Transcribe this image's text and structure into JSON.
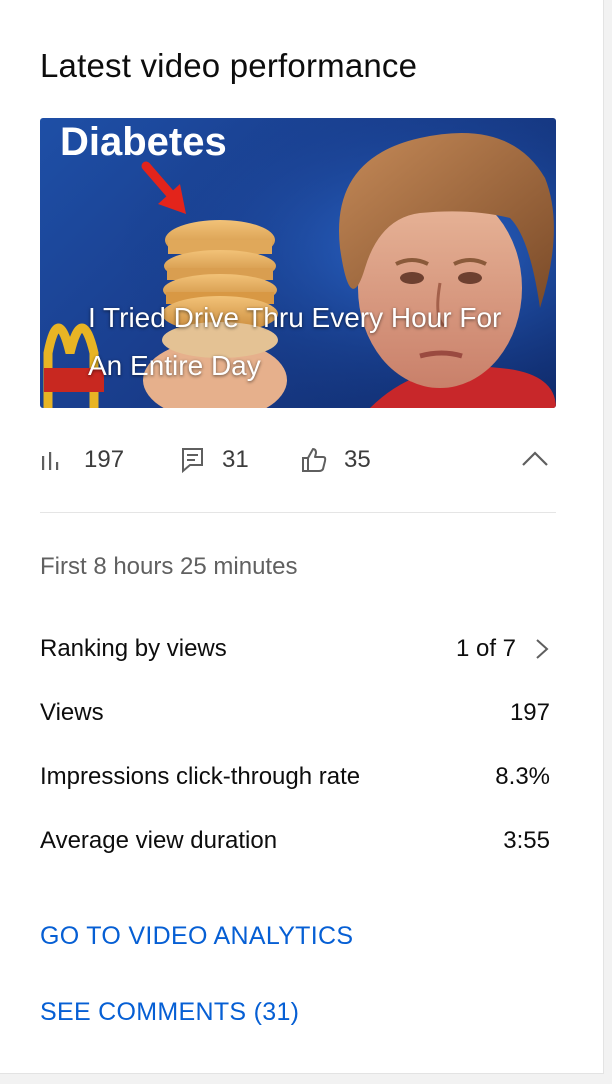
{
  "card": {
    "title": "Latest video performance",
    "thumbnail": {
      "tag_text": "Diabetes",
      "caption": "I Tried Drive Thru Every Hour For An Entire Day"
    },
    "stats": {
      "views": "197",
      "comments": "31",
      "likes": "35"
    },
    "period": "First 8 hours 25 minutes",
    "metrics": [
      {
        "label": "Ranking by views",
        "value": "1 of 7"
      },
      {
        "label": "Views",
        "value": "197"
      },
      {
        "label": "Impressions click-through rate",
        "value": "8.3%"
      },
      {
        "label": "Average view duration",
        "value": "3:55"
      }
    ],
    "links": {
      "analytics": "GO TO VIDEO ANALYTICS",
      "comments": "SEE COMMENTS (31)"
    }
  },
  "icons": {
    "views": "bar-chart-icon",
    "comments": "comment-icon",
    "likes": "thumbs-up-icon",
    "collapse": "chevron-up-icon",
    "ranking": "chevron-right-icon"
  },
  "colors": {
    "link": "#065fd4",
    "secondary_text": "#606060",
    "thumb_bg": "#1e4fa6"
  }
}
